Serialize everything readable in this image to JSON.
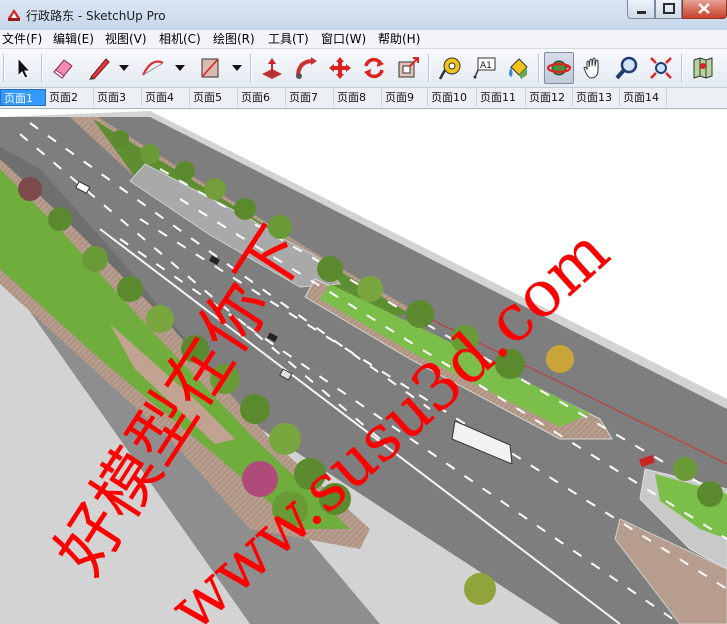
{
  "window": {
    "title": "行政路东 - SketchUp Pro"
  },
  "menu": [
    {
      "label": "文件(F)"
    },
    {
      "label": "编辑(E)"
    },
    {
      "label": "视图(V)"
    },
    {
      "label": "相机(C)"
    },
    {
      "label": "绘图(R)"
    },
    {
      "label": "工具(T)"
    },
    {
      "label": "窗口(W)"
    },
    {
      "label": "帮助(H)"
    }
  ],
  "toolbar": {
    "tools": [
      {
        "icon": "select-arrow-icon"
      },
      {
        "icon": "eraser-icon"
      },
      {
        "icon": "pencil-line-icon"
      },
      {
        "icon": "arc-icon"
      },
      {
        "icon": "rectangle-icon"
      },
      {
        "icon": "push-pull-icon"
      },
      {
        "icon": "follow-me-icon"
      },
      {
        "icon": "move-icon"
      },
      {
        "icon": "rotate-icon"
      },
      {
        "icon": "offset-icon"
      },
      {
        "icon": "tape-measure-icon"
      },
      {
        "icon": "text-label-icon"
      },
      {
        "icon": "paint-bucket-icon"
      },
      {
        "icon": "orbit-icon"
      },
      {
        "icon": "pan-hand-icon"
      },
      {
        "icon": "zoom-icon"
      },
      {
        "icon": "zoom-extents-icon"
      },
      {
        "icon": "map-location-icon"
      }
    ],
    "text_tool_label": "A1"
  },
  "tabs": [
    "页面1",
    "页面2",
    "页面3",
    "页面4",
    "页面5",
    "页面6",
    "页面7",
    "页面8",
    "页面9",
    "页面10",
    "页面11",
    "页面12",
    "页面13",
    "页面14"
  ],
  "active_tab": 0,
  "watermark": {
    "line1": "好模型在你下",
    "line2": "www.susu3d.com"
  },
  "colors": {
    "asphalt": "#7b7b7b",
    "lane_marking": "#ffffff",
    "median_paving": "#b59a8a",
    "grass": "#7cbe4a",
    "curb": "#9a9a9a",
    "sidewalk": "#c9c9c9",
    "watermark": "#ff0000",
    "tab_active": "#3399ff"
  }
}
